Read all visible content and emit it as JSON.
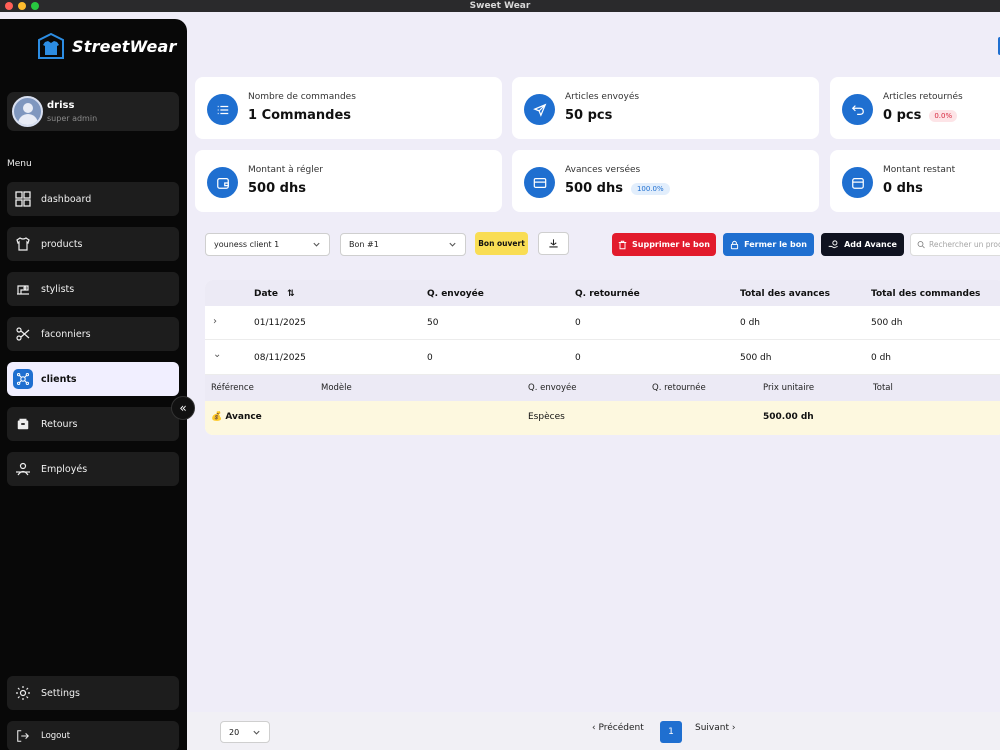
{
  "window": {
    "title": "Sweet Wear"
  },
  "colors": {
    "accent": "#1f6fd0",
    "danger": "#e21b2c",
    "dark": "#0f1220",
    "warning": "#f9dd54"
  },
  "sidebar": {
    "brand": "StreetWear",
    "user": {
      "name": "driss",
      "role": "super admin"
    },
    "menu_heading": "Menu",
    "items": [
      {
        "label": "dashboard",
        "icon": "grid-icon"
      },
      {
        "label": "products",
        "icon": "shirt-icon"
      },
      {
        "label": "stylists",
        "icon": "sewing-machine-icon"
      },
      {
        "label": "faconniers",
        "icon": "scissors-icon"
      },
      {
        "label": "clients",
        "icon": "clients-icon",
        "active": true
      },
      {
        "label": "Retours",
        "icon": "box-icon"
      },
      {
        "label": "Employés",
        "icon": "employees-icon"
      }
    ],
    "settings": "Settings",
    "logout": "Logout"
  },
  "stats": [
    {
      "label": "Nombre de commandes",
      "value": "1 Commandes",
      "icon": "list-icon"
    },
    {
      "label": "Articles envoyés",
      "value": "50 pcs",
      "icon": "send-icon"
    },
    {
      "label": "Articles retournés",
      "value": "0 pcs",
      "badge": "0.0%",
      "icon": "undo-icon"
    },
    {
      "label": "Montant à régler",
      "value": "500 dhs",
      "icon": "wallet-icon"
    },
    {
      "label": "Avances versées",
      "value": "500 dhs",
      "badge": "100.0%",
      "icon": "card-icon"
    },
    {
      "label": "Montant restant",
      "value": "0 dhs",
      "icon": "wallet-icon"
    }
  ],
  "toolbar": {
    "client_select": "youness client 1",
    "bon_select": "Bon #1",
    "status_badge": "Bon ouvert",
    "delete_label": "Supprimer le bon",
    "close_label": "Fermer le bon",
    "add_advance_label": "Add Avance",
    "search_placeholder": "Rechercher un produit"
  },
  "table": {
    "headers": [
      "Date",
      "Q. envoyée",
      "Q. retournée",
      "Total des avances",
      "Total des commandes"
    ],
    "rows": [
      {
        "date": "01/11/2025",
        "sent": "50",
        "returned": "0",
        "advances": "0 dh",
        "orders": "500 dh",
        "expanded": false
      },
      {
        "date": "08/11/2025",
        "sent": "0",
        "returned": "0",
        "advances": "500 dh",
        "orders": "0 dh",
        "expanded": true
      }
    ],
    "sub_headers": [
      "Référence",
      "Modèle",
      "Q. envoyée",
      "Q. retournée",
      "Prix unitaire",
      "Total"
    ],
    "sub_rows": [
      {
        "reference": "Avance",
        "icon": "money-bag-icon",
        "sent": "Espèces",
        "unit_price": "500.00 dh"
      }
    ]
  },
  "pagination": {
    "page_size": "20",
    "prev": "Précédent",
    "current": "1",
    "next": "Suivant"
  }
}
